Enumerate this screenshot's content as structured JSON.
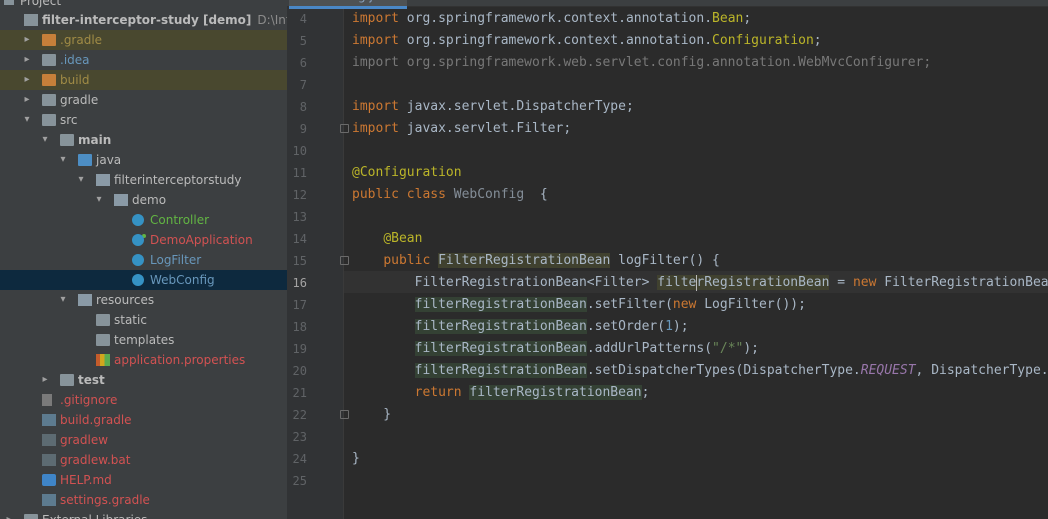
{
  "project": {
    "header": "Project",
    "tree": [
      {
        "label": "filter-interceptor-study [demo]",
        "path": "D:\\IntelliJ IDEA\\",
        "level": 0,
        "arrow": "",
        "icon": "proj",
        "color": "bold",
        "state": ""
      },
      {
        "label": ".gradle",
        "level": 1,
        "arrow": "right",
        "icon": "folder-orange",
        "color": "orange",
        "state": "hl"
      },
      {
        "label": ".idea",
        "level": 1,
        "arrow": "right",
        "icon": "folder",
        "color": "blue",
        "state": ""
      },
      {
        "label": "build",
        "level": 1,
        "arrow": "right",
        "icon": "folder-orange",
        "color": "orange",
        "state": "hl"
      },
      {
        "label": "gradle",
        "level": 1,
        "arrow": "right",
        "icon": "folder",
        "color": "default",
        "state": ""
      },
      {
        "label": "src",
        "level": 1,
        "arrow": "down",
        "icon": "folder",
        "color": "default",
        "state": ""
      },
      {
        "label": "main",
        "level": 2,
        "arrow": "down",
        "icon": "folder",
        "color": "bold",
        "state": ""
      },
      {
        "label": "java",
        "level": 3,
        "arrow": "down",
        "icon": "folder-blue",
        "color": "default",
        "state": ""
      },
      {
        "label": "filterinterceptorstudy",
        "level": 4,
        "arrow": "down",
        "icon": "pkg",
        "color": "default",
        "state": ""
      },
      {
        "label": "demo",
        "level": 5,
        "arrow": "down",
        "icon": "pkg",
        "color": "default",
        "state": ""
      },
      {
        "label": "Controller",
        "level": 6,
        "arrow": "",
        "icon": "cls",
        "color": "green",
        "state": ""
      },
      {
        "label": "DemoApplication",
        "level": 6,
        "arrow": "",
        "icon": "cls-run",
        "color": "red",
        "state": ""
      },
      {
        "label": "LogFilter",
        "level": 6,
        "arrow": "",
        "icon": "cls",
        "color": "blue",
        "state": ""
      },
      {
        "label": "WebConfig",
        "level": 6,
        "arrow": "",
        "icon": "cls",
        "color": "blue",
        "state": "sel"
      },
      {
        "label": "resources",
        "level": 3,
        "arrow": "down",
        "icon": "res",
        "color": "default",
        "state": ""
      },
      {
        "label": "static",
        "level": 4,
        "arrow": "",
        "icon": "folder",
        "color": "default",
        "state": ""
      },
      {
        "label": "templates",
        "level": 4,
        "arrow": "",
        "icon": "folder",
        "color": "default",
        "state": ""
      },
      {
        "label": "application.properties",
        "level": 4,
        "arrow": "",
        "icon": "props",
        "color": "red",
        "state": ""
      },
      {
        "label": "test",
        "level": 2,
        "arrow": "right",
        "icon": "folder",
        "color": "bold",
        "state": ""
      },
      {
        "label": ".gitignore",
        "level": 1,
        "arrow": "",
        "icon": "git",
        "color": "red",
        "state": ""
      },
      {
        "label": "build.gradle",
        "level": 1,
        "arrow": "",
        "icon": "gradle",
        "color": "red",
        "state": ""
      },
      {
        "label": "gradlew",
        "level": 1,
        "arrow": "",
        "icon": "term",
        "color": "red",
        "state": ""
      },
      {
        "label": "gradlew.bat",
        "level": 1,
        "arrow": "",
        "icon": "term",
        "color": "red",
        "state": ""
      },
      {
        "label": "HELP.md",
        "level": 1,
        "arrow": "",
        "icon": "md",
        "color": "red",
        "state": ""
      },
      {
        "label": "settings.gradle",
        "level": 1,
        "arrow": "",
        "icon": "gradle",
        "color": "red",
        "state": ""
      },
      {
        "label": "External Libraries",
        "level": 0,
        "arrow": "right",
        "icon": "folder",
        "color": "default",
        "state": ""
      }
    ]
  },
  "editor": {
    "tab_label": "WebConfig.java",
    "current_line": 16,
    "lines": [
      {
        "n": 4,
        "fold": "",
        "html": "<span class=\"kw\">import</span> org.springframework.context.annotation.<span class=\"ann\">Bean</span>;"
      },
      {
        "n": 5,
        "fold": "",
        "html": "<span class=\"kw\">import</span> org.springframework.context.annotation.<span class=\"ann\">Configuration</span>;"
      },
      {
        "n": 6,
        "fold": "",
        "html": "<span class=\"gray\">import org.springframework.web.servlet.config.annotation.WebMvcConfigurer;</span>"
      },
      {
        "n": 7,
        "fold": "",
        "html": ""
      },
      {
        "n": 8,
        "fold": "",
        "html": "<span class=\"kw\">import</span> javax.servlet.DispatcherType;"
      },
      {
        "n": 9,
        "fold": "end",
        "html": "<span class=\"kw\">import</span> javax.servlet.Filter;"
      },
      {
        "n": 10,
        "fold": "",
        "html": ""
      },
      {
        "n": 11,
        "fold": "",
        "html": "<span class=\"ann\">@Configuration</span>"
      },
      {
        "n": 12,
        "fold": "",
        "html": "<span class=\"kw\">public class</span> <span class=\"dim-cls\">WebConfig</span>  {"
      },
      {
        "n": 13,
        "fold": "",
        "html": ""
      },
      {
        "n": 14,
        "fold": "",
        "html": "    <span class=\"ann\">@Bean</span>"
      },
      {
        "n": 15,
        "fold": "start",
        "html": "    <span class=\"kw\">public</span> <span class=\"usage-strong\">FilterRegistrationBean</span> logFilter() {"
      },
      {
        "n": 16,
        "fold": "",
        "html": "        FilterRegistrationBean&lt;Filter&gt; <span class=\"usage-strong\">filte<span class=\"caret\"></span>rRegistrationBean</span> = <span class=\"kw\">new</span> FilterRegistrationBean&lt;&gt;();"
      },
      {
        "n": 17,
        "fold": "",
        "html": "        <span class=\"usage\">filterRegistrationBean</span>.setFilter(<span class=\"kw\">new</span> LogFilter());"
      },
      {
        "n": 18,
        "fold": "",
        "html": "        <span class=\"usage\">filterRegistrationBean</span>.setOrder(<span class=\"num\">1</span>);"
      },
      {
        "n": 19,
        "fold": "",
        "html": "        <span class=\"usage\">filterRegistrationBean</span>.addUrlPatterns(<span class=\"str\">\"/*\"</span>);"
      },
      {
        "n": 20,
        "fold": "",
        "html": "        <span class=\"usage\">filterRegistrationBean</span>.setDispatcherTypes(DispatcherType.<span class=\"cst\">REQUEST</span>, DispatcherType.<span class=\"cst\">ERROR</span>);"
      },
      {
        "n": 21,
        "fold": "",
        "html": "        <span class=\"kw\">return</span> <span class=\"usage\">filterRegistrationBean</span>;"
      },
      {
        "n": 22,
        "fold": "end",
        "html": "    }"
      },
      {
        "n": 23,
        "fold": "",
        "html": ""
      },
      {
        "n": 24,
        "fold": "",
        "html": "}"
      },
      {
        "n": 25,
        "fold": "",
        "html": ""
      }
    ]
  }
}
